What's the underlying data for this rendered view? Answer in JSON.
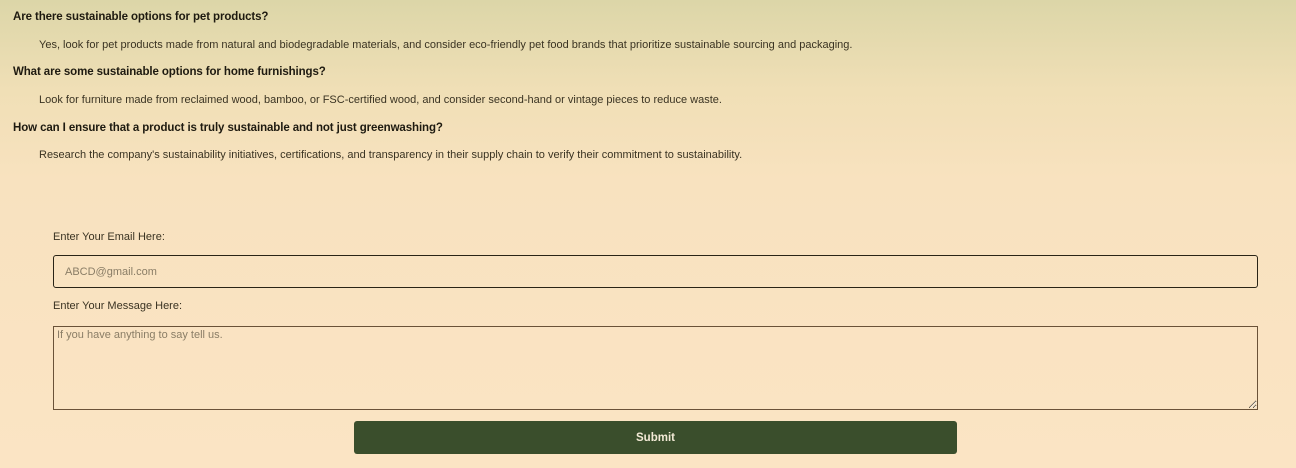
{
  "faq": [
    {
      "question": "Are there sustainable options for pet products?",
      "answer": "Yes, look for pet products made from natural and biodegradable materials, and consider eco-friendly pet food brands that prioritize sustainable sourcing and packaging."
    },
    {
      "question": "What are some sustainable options for home furnishings?",
      "answer": "Look for furniture made from reclaimed wood, bamboo, or FSC-certified wood, and consider second-hand or vintage pieces to reduce waste."
    },
    {
      "question": "How can I ensure that a product is truly sustainable and not just greenwashing?",
      "answer": "Research the company's sustainability initiatives, certifications, and transparency in their supply chain to verify their commitment to sustainability."
    }
  ],
  "form": {
    "email_label": "Enter Your Email Here:",
    "email_placeholder": "ABCD@gmail.com",
    "email_value": "",
    "message_label": "Enter Your Message Here:",
    "message_placeholder": "If you have anything to say tell us.",
    "message_value": "",
    "submit_label": "Submit"
  },
  "colors": {
    "submit_background": "#3a4e2c",
    "background_top": "#dcd6a8",
    "background_bottom": "#fbe4c4"
  }
}
